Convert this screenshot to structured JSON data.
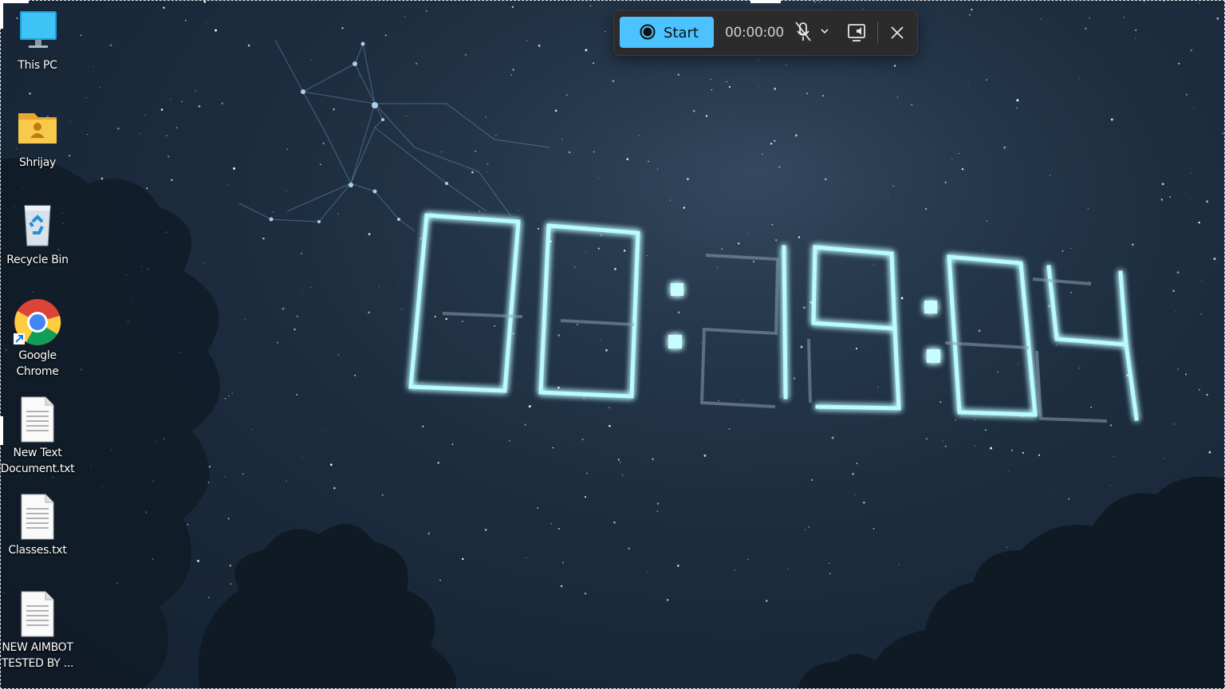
{
  "desktop": {
    "icons": [
      {
        "label": "This PC",
        "icon": "monitor-icon"
      },
      {
        "label": "Shrijay",
        "icon": "user-folder-icon"
      },
      {
        "label": "Recycle Bin",
        "icon": "recycle-bin-icon"
      },
      {
        "label": "Google\nChrome",
        "icon": "chrome-icon"
      },
      {
        "label": "New Text\nDocument.txt",
        "icon": "text-file-icon"
      },
      {
        "label": "Classes.txt",
        "icon": "text-file-icon"
      },
      {
        "label": "NEW AIMBOT\nTESTED BY ...",
        "icon": "text-file-icon"
      }
    ]
  },
  "wallpaper": {
    "clock_text": "00:19:04"
  },
  "recorder": {
    "start_label": "Start",
    "elapsed": "00:00:00",
    "colors": {
      "accent": "#4cc2ff",
      "toolbar_bg": "#2b2b2b"
    },
    "icons": [
      "record-icon",
      "microphone-muted-icon",
      "chevron-down-icon",
      "system-audio-icon",
      "close-icon"
    ]
  },
  "colors": {
    "sky": "#1d2d3f",
    "glow": "#4ee8f0"
  }
}
